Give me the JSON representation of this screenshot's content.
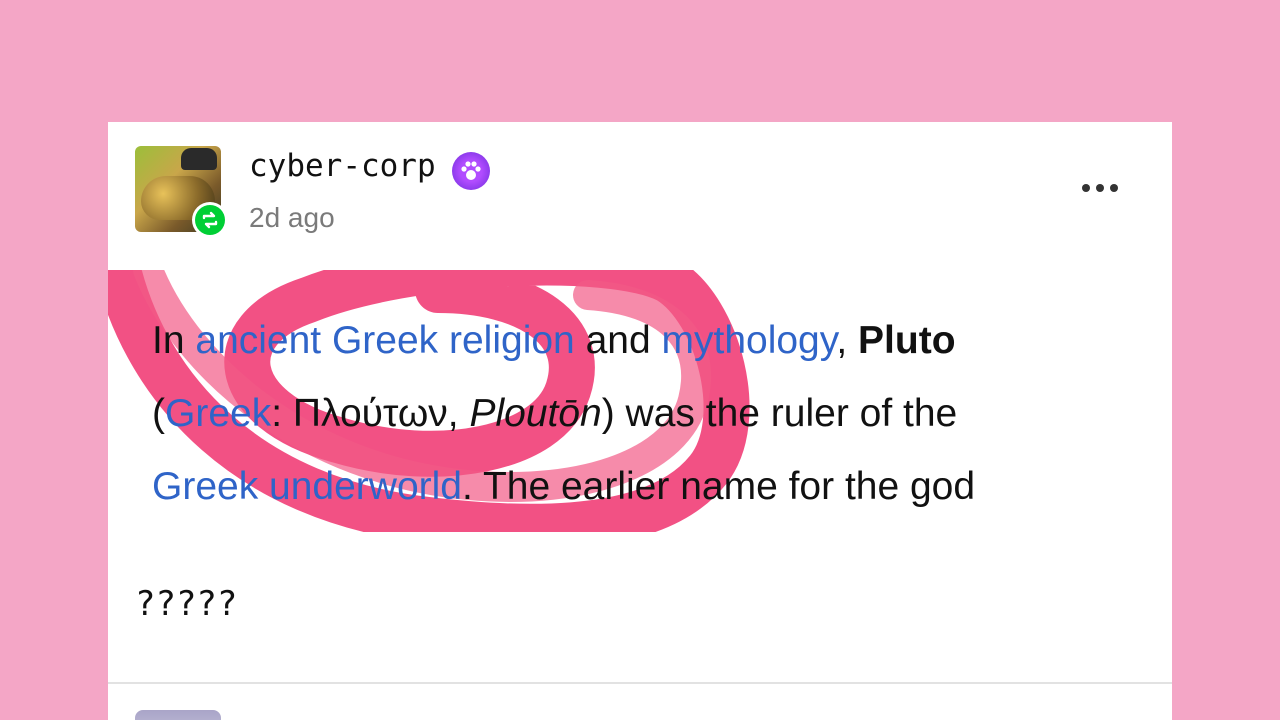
{
  "post": {
    "username": "cyber-corp",
    "timestamp": "2d ago",
    "badge_icon": "paw-badge-icon",
    "reblog_icon": "reblog-icon",
    "menu_icon": "more-options-icon",
    "excerpt": {
      "w_in": "In ",
      "link_ancient_greek_religion": "ancient Greek religion",
      "w_and": " and ",
      "link_mythology": "mythology",
      "w_comma": ", ",
      "bold_pluto": "Pluto",
      "w_open_paren": "(",
      "link_greek": "Greek",
      "w_colon_greek_name": ": Πλούτων, ",
      "italic_plouton": "Ploutōn",
      "w_ruler": ") was the ruler of the",
      "link_greek_underworld": "Greek underworld",
      "w_tail": ". The earlier name for the god"
    },
    "caption": "?????"
  },
  "colors": {
    "background": "#f4a6c6",
    "link": "#2f64c8",
    "scribble": "#f0336f",
    "reblog_green": "#00cf35",
    "paw_purple": "#b14cff"
  }
}
